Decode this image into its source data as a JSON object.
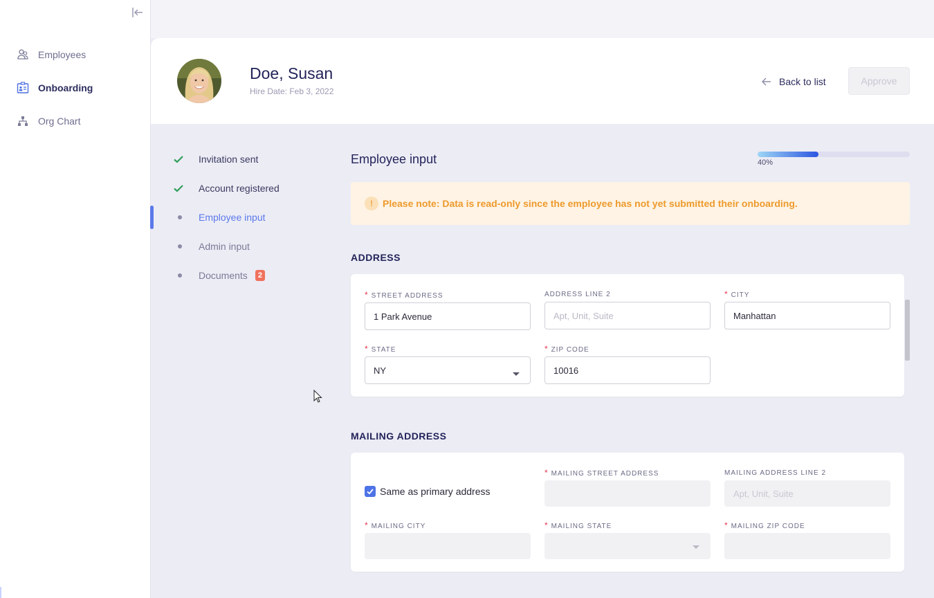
{
  "sidebar": {
    "items": [
      {
        "label": "Employees",
        "icon": "employees-icon"
      },
      {
        "label": "Onboarding",
        "icon": "onboarding-icon",
        "active": true
      },
      {
        "label": "Org Chart",
        "icon": "org-chart-icon"
      }
    ]
  },
  "header": {
    "name": "Doe, Susan",
    "hire_date": "Hire Date: Feb 3, 2022",
    "back_label": "Back to list",
    "approve_label": "Approve"
  },
  "steps": [
    {
      "label": "Invitation sent",
      "state": "done"
    },
    {
      "label": "Account registered",
      "state": "done"
    },
    {
      "label": "Employee input",
      "state": "current"
    },
    {
      "label": "Admin input",
      "state": "pending"
    },
    {
      "label": "Documents",
      "state": "pending",
      "badge": "2"
    }
  ],
  "section": {
    "title": "Employee input",
    "progress_percent": 40,
    "progress_label": "40%",
    "notice": "Please note: Data is read-only since the employee has not yet submitted their onboarding."
  },
  "address": {
    "title": "ADDRESS",
    "street_label": "STREET ADDRESS",
    "street_value": "1 Park Avenue",
    "line2_label": "ADDRESS LINE 2",
    "line2_placeholder": "Apt, Unit, Suite",
    "city_label": "CITY",
    "city_value": "Manhattan",
    "state_label": "STATE",
    "state_value": "NY",
    "zip_label": "ZIP CODE",
    "zip_value": "10016"
  },
  "mailing": {
    "title": "MAILING ADDRESS",
    "same_label": "Same as primary address",
    "street_label": "MAILING STREET ADDRESS",
    "line2_label": "MAILING ADDRESS LINE 2",
    "line2_placeholder": "Apt, Unit, Suite",
    "city_label": "MAILING CITY",
    "state_label": "MAILING STATE",
    "zip_label": "MAILING ZIP CODE"
  },
  "colors": {
    "accent": "#5b79ea",
    "check_green": "#2f9e5a",
    "notice_text": "#ee9a2c",
    "badge": "#f0725c"
  }
}
